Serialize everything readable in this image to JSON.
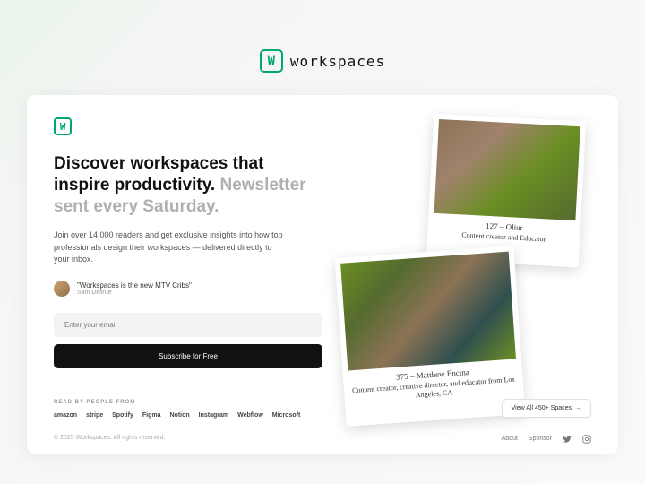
{
  "brand": {
    "letter": "W",
    "name": "workspaces"
  },
  "hero": {
    "headline_main": "Discover workspaces that inspire productivity.",
    "headline_muted": "Newsletter sent every Saturday.",
    "subtext": "Join over 14,000 readers and get exclusive insights into how top professionals design their workspaces — delivered directly to your inbox."
  },
  "testimonial": {
    "quote": "\"Workspaces is the new MTV Cribs\"",
    "author": "Sam Dellrue"
  },
  "form": {
    "email_placeholder": "Enter your email",
    "button_label": "Subscribe for Free"
  },
  "readby": {
    "label": "READ BY PEOPLE FROM",
    "companies": [
      "amazon",
      "stripe",
      "Spotify",
      "Figma",
      "Notion",
      "Instagram",
      "Webflow",
      "Microsoft"
    ]
  },
  "copyright": "© 2025 Workspaces. All rights reserved.",
  "polaroids": {
    "p1": {
      "title": "127 – Oliur",
      "sub": "Content creator and Educator"
    },
    "p2": {
      "title": "375 – Matthew Encina",
      "sub": "Content creator, creative director, and educator from Los Angeles, CA"
    }
  },
  "viewall": "View All 450+ Spaces",
  "footer": {
    "about": "About",
    "sponsor": "Sponsor"
  }
}
